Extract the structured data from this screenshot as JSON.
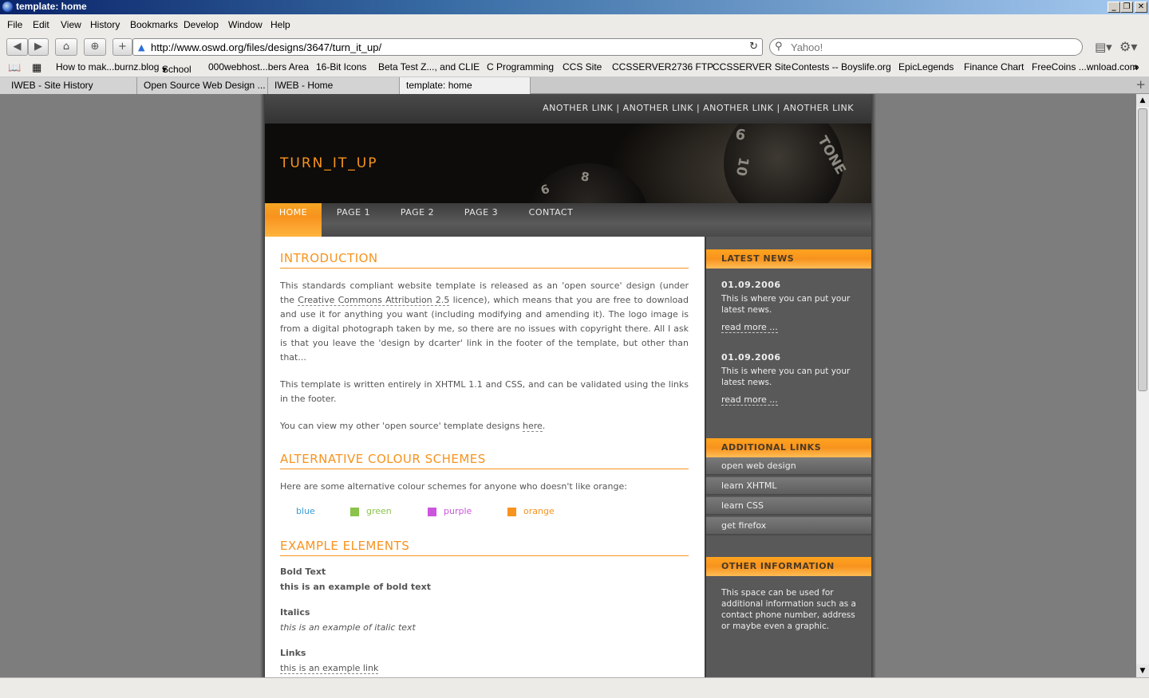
{
  "window": {
    "title": "template: home"
  },
  "menu": [
    "File",
    "Edit",
    "View",
    "History",
    "Bookmarks",
    "Develop",
    "Window",
    "Help"
  ],
  "toolbar": {
    "url": "http://www.oswd.org/files/designs/3647/turn_it_up/",
    "search_placeholder": "Yahoo!"
  },
  "bookmarks": [
    "How to mak...burnz.blog",
    "School",
    "000webhost...bers Area",
    "16-Bit Icons",
    "Beta Test Z..., and CLIE",
    "C Programming",
    "CCS Site",
    "CCSSERVER2736 FTP",
    "CCSSERVER Site",
    "Contests -- Boyslife.org",
    "EpicLegends",
    "Finance Chart",
    "FreeCoins ...wnload.com"
  ],
  "tabs": [
    "IWEB - Site History",
    "Open Source Web Design ...",
    "IWEB - Home",
    "template: home"
  ],
  "site": {
    "top_links": [
      "ANOTHER LINK",
      "ANOTHER LINK",
      "ANOTHER LINK",
      "ANOTHER LINK"
    ],
    "separator": "|",
    "brand": "TURN_IT_UP",
    "nav": [
      "HOME",
      "PAGE 1",
      "PAGE 2",
      "PAGE 3",
      "CONTACT"
    ],
    "intro_heading": "INTRODUCTION",
    "intro_p1_a": "This standards compliant website template is released as an 'open source' design (under the ",
    "intro_p1_link": "Creative Commons Attribution 2.5",
    "intro_p1_b": " licence), which means that you are free to download and use it for anything you want (including modifying and amending it). The logo image is from a digital photograph taken by me, so there are no issues with copyright there. All I ask is that you leave the 'design by dcarter' link in the footer of the template, but other than that...",
    "intro_p2": "This template is written entirely in XHTML 1.1 and CSS, and can be validated using the links in the footer.",
    "intro_p3_a": "You can view my other 'open source' template designs ",
    "intro_p3_link": "here",
    "intro_p3_b": ".",
    "alt_heading": "ALTERNATIVE COLOUR SCHEMES",
    "alt_text": "Here are some alternative colour schemes for anyone who doesn't like orange:",
    "schemes": [
      {
        "label": "blue",
        "color": "#3a9bd5"
      },
      {
        "label": "green",
        "color": "#8bc34a"
      },
      {
        "label": "purple",
        "color": "#cc55dd"
      },
      {
        "label": "orange",
        "color": "#f7931e"
      }
    ],
    "examples_heading": "EXAMPLE ELEMENTS",
    "examples": [
      {
        "label": "Bold Text",
        "value": "this is an example of bold text"
      },
      {
        "label": "Italics",
        "value": "this is an example of italic text"
      },
      {
        "label": "Links",
        "value": "this is an example link"
      }
    ],
    "sidebar": {
      "news_heading": "LATEST NEWS",
      "news": [
        {
          "date": "01.09.2006",
          "text": "This is where you can put your latest news.",
          "more": "read more ..."
        },
        {
          "date": "01.09.2006",
          "text": "This is where you can put your latest news.",
          "more": "read more ..."
        }
      ],
      "links_heading": "ADDITIONAL LINKS",
      "links": [
        "open web design",
        "learn XHTML",
        "learn CSS",
        "get firefox"
      ],
      "other_heading": "OTHER INFORMATION",
      "other_text": "This space can be used for additional information such as a contact phone number, address or maybe even a graphic."
    }
  },
  "colors": {
    "accent": "#f7931e",
    "sidebar": "#595959",
    "page_bg": "#7d7d7d"
  }
}
